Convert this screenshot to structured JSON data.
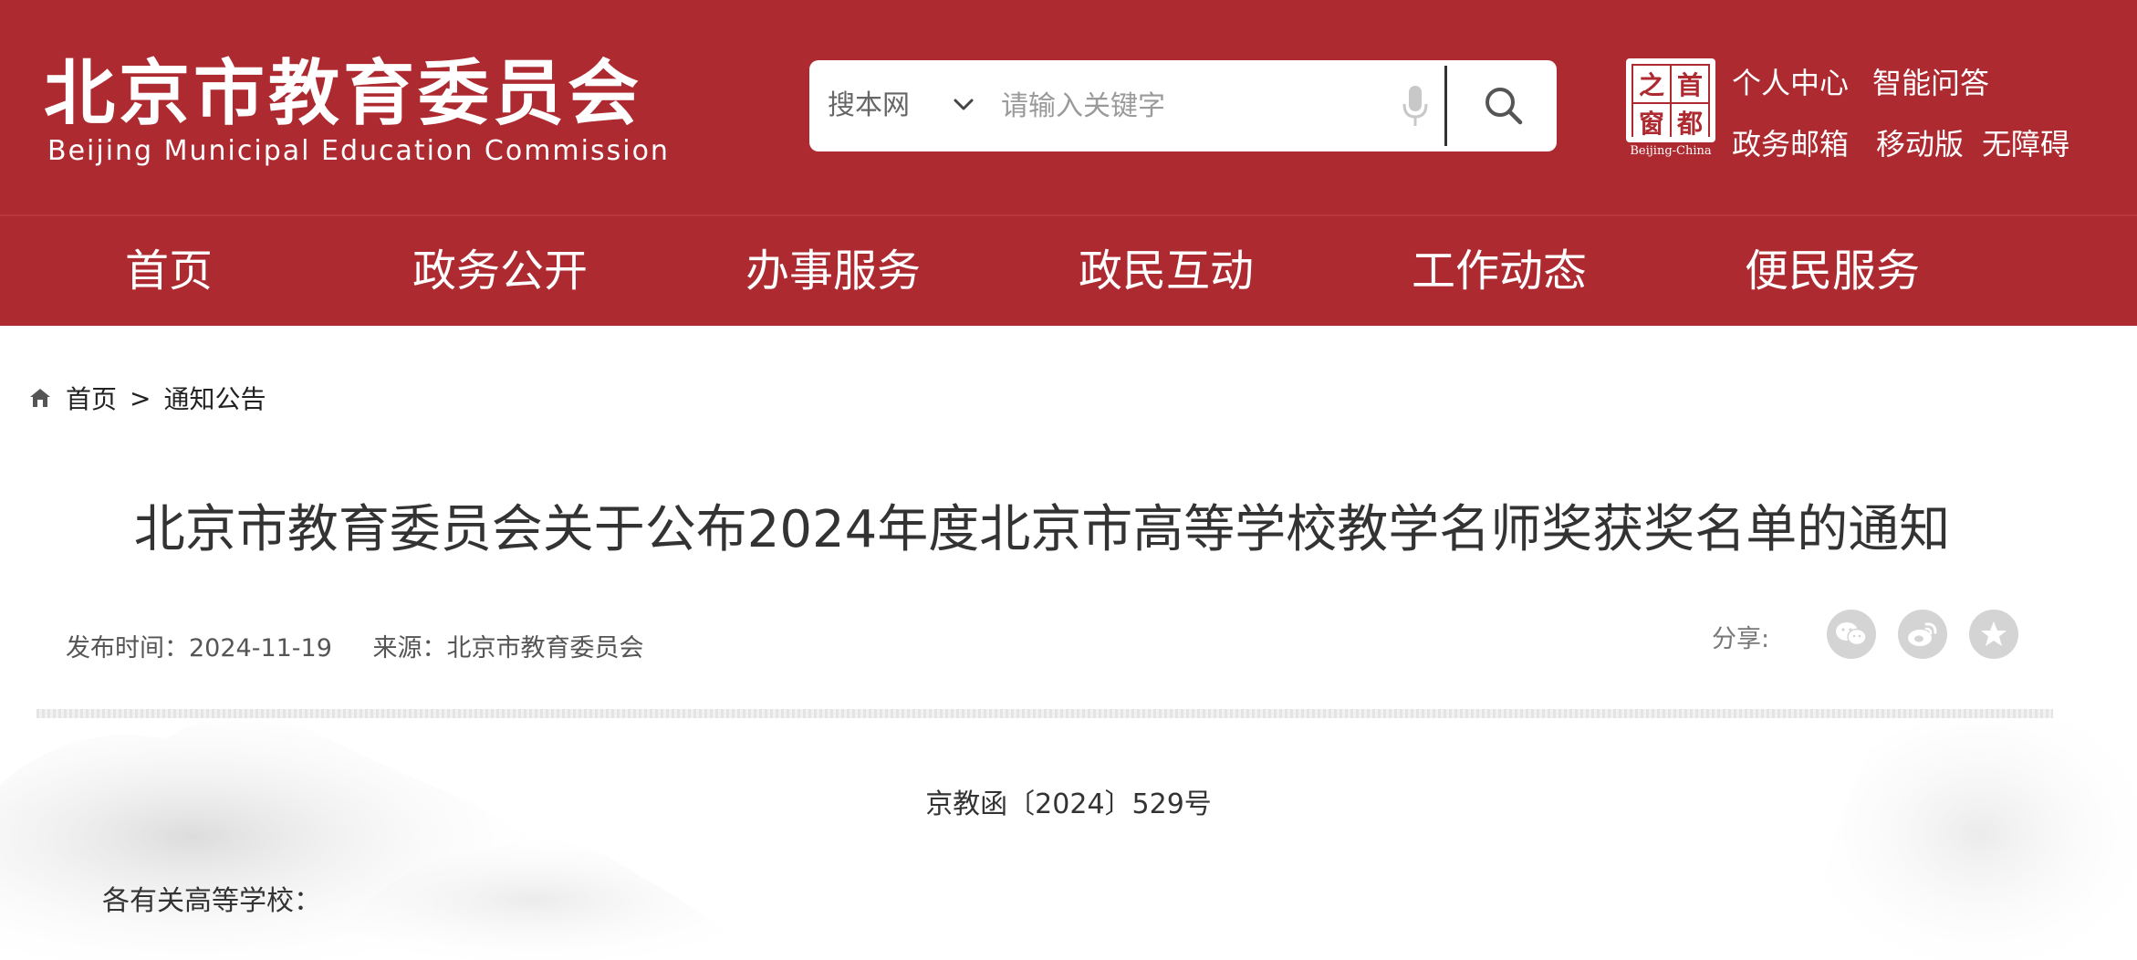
{
  "header": {
    "logo_cn": "北京市教育委员会",
    "logo_en": "Beijing Municipal Education Commission",
    "search": {
      "scope": "搜本网",
      "placeholder": "请输入关键字"
    },
    "capital_badge": {
      "chars": [
        "之",
        "首",
        "窗",
        "都"
      ],
      "sub": "Beijing-China"
    },
    "links": {
      "personal_center": "个人中心",
      "smart_qa": "智能问答",
      "gov_mail": "政务邮箱",
      "mobile": "移动版",
      "accessibility": "无障碍"
    }
  },
  "nav": {
    "items": [
      "首页",
      "政务公开",
      "办事服务",
      "政民互动",
      "工作动态",
      "便民服务"
    ]
  },
  "breadcrumb": {
    "home": "首页",
    "separator": ">",
    "current": "通知公告"
  },
  "article": {
    "title": "北京市教育委员会关于公布2024年度北京市高等学校教学名师奖获奖名单的通知",
    "publish_time": "发布时间：2024-11-19",
    "source": "来源：北京市教育委员会",
    "share_label": "分享:",
    "doc_number": "京教函〔2024〕529号",
    "salutation": "各有关高等学校："
  },
  "icons": {
    "share": [
      "wechat-icon",
      "weibo-icon",
      "favorite-icon"
    ]
  },
  "colors": {
    "brand_red": "#ad2a31",
    "share_gray": "#d4d4d4"
  }
}
